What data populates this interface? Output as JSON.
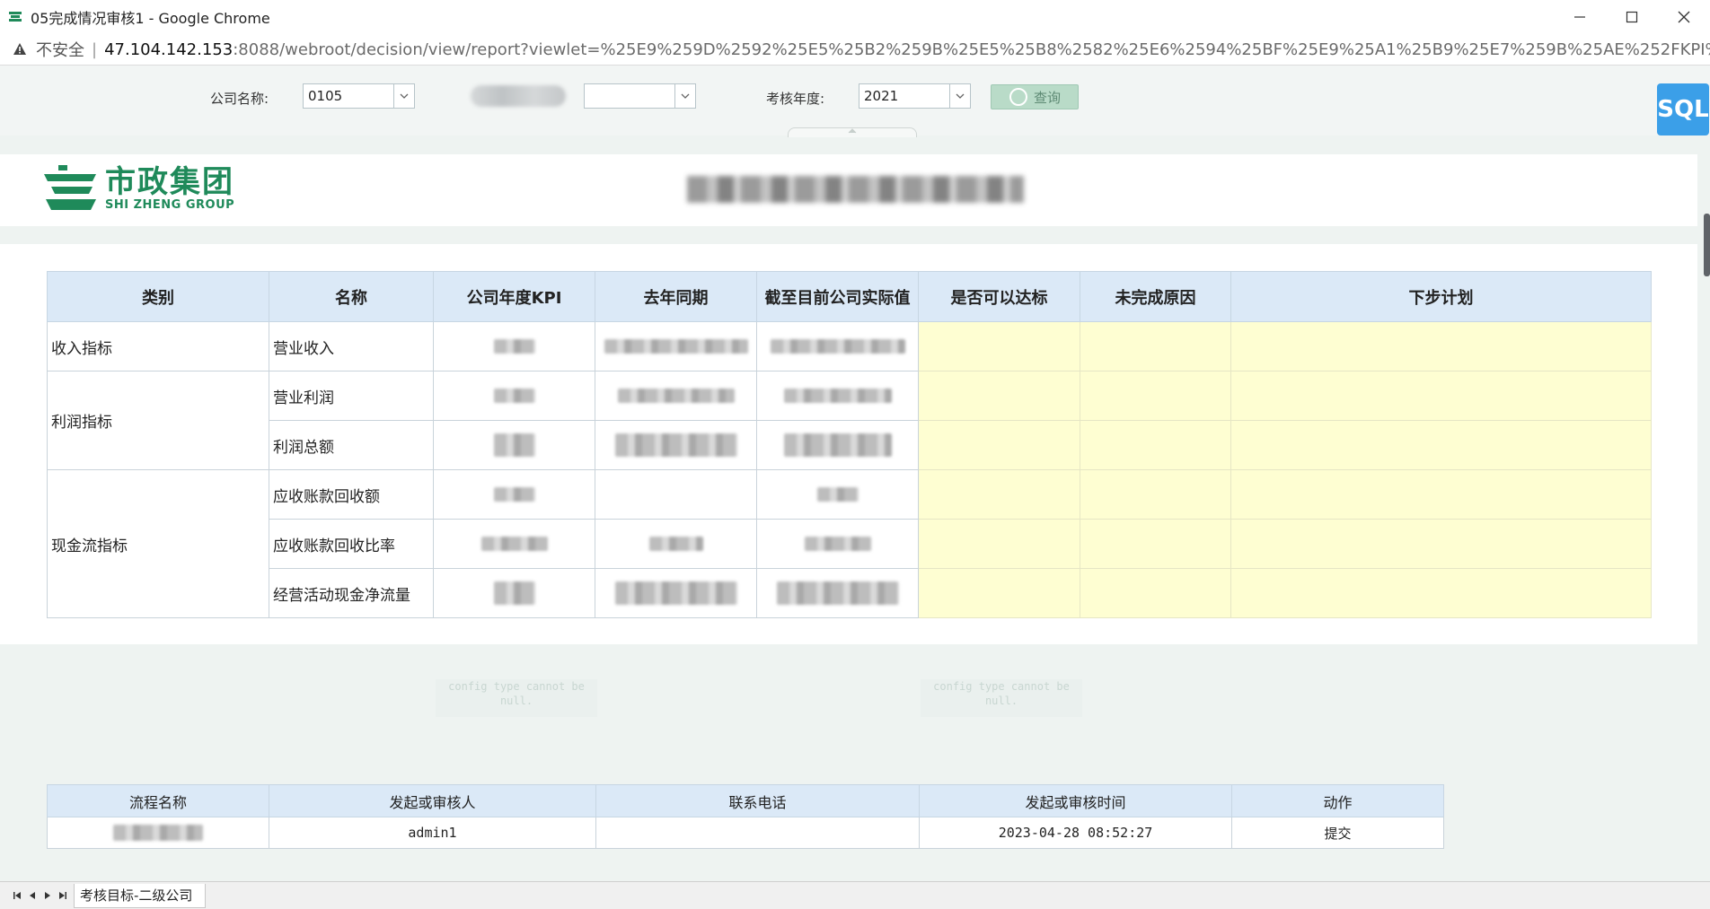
{
  "window": {
    "title": "05完成情况审核1 - Google Chrome"
  },
  "address": {
    "insecure_label": "不安全",
    "separator": "|",
    "host": "47.104.142.153",
    "rest": ":8088/webroot/decision/view/report?viewlet=%25E9%259D%2592%25E5%25B2%259B%25E5%25B8%2582%25E6%2594%25BF%25E9%25A1%25B9%25E7%259B%25AE%252FKPI%25E6%258C%..."
  },
  "params": {
    "company_label": "公司名称:",
    "company_value": "0105",
    "second_value": "",
    "year_label": "考核年度:",
    "year_value": "2021",
    "query_label": "查询"
  },
  "sql_badge": "SQL",
  "logo": {
    "cn": "市政集团",
    "en": "SHI ZHENG GROUP"
  },
  "kpi_table": {
    "headers": [
      "类别",
      "名称",
      "公司年度KPI",
      "去年同期",
      "截至目前公司实际值",
      "是否可以达标",
      "未完成原因",
      "下步计划"
    ],
    "categories": {
      "income": "收入指标",
      "profit": "利润指标",
      "cashflow": "现金流指标"
    },
    "rows": [
      {
        "name": "营业收入"
      },
      {
        "name": "营业利润"
      },
      {
        "name": "利润总额"
      },
      {
        "name": "应收账款回收额"
      },
      {
        "name": "应收账款回收比率"
      },
      {
        "name": "经营活动现金净流量"
      }
    ]
  },
  "notes": {
    "config_note_1": "config type cannot be null.",
    "config_note_2": "config type cannot be null."
  },
  "flow_table": {
    "headers": [
      "流程名称",
      "发起或审核人",
      "联系电话",
      "发起或审核时间",
      "动作"
    ],
    "row": {
      "process_name": "",
      "person": "admin1",
      "phone": "",
      "time": "2023-04-28 08:52:27",
      "action": "提交"
    }
  },
  "sheet_tabs": {
    "active": "考核目标-二级公司"
  },
  "colors": {
    "brand_green": "#1f8a5a",
    "header_blue": "#dbe9f7",
    "input_yellow": "#fefed2",
    "sql_blue": "#3b9fe8",
    "query_green": "#b9dbc8"
  }
}
